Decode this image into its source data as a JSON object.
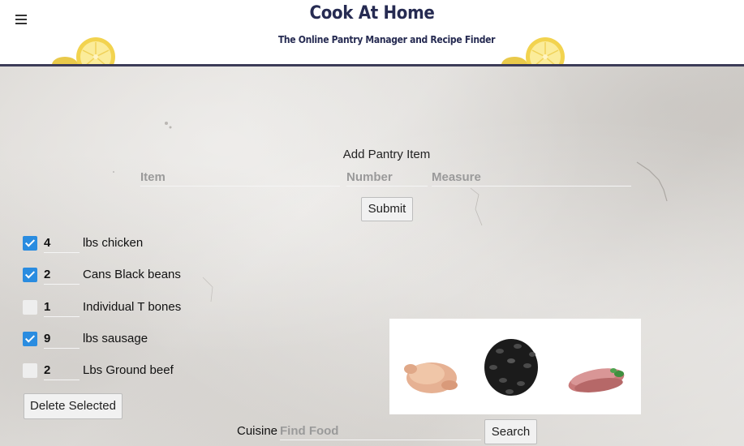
{
  "header": {
    "title": "Cook At Home",
    "subtitle": "The Online Pantry Manager and Recipe Finder"
  },
  "form": {
    "heading": "Add Pantry Item",
    "item_placeholder": "Item",
    "number_placeholder": "Number",
    "measure_placeholder": "Measure",
    "submit_label": "Submit"
  },
  "pantry": {
    "items": [
      {
        "checked": true,
        "quantity": "4",
        "description": "lbs chicken"
      },
      {
        "checked": true,
        "quantity": "2",
        "description": "Cans Black beans"
      },
      {
        "checked": false,
        "quantity": "1",
        "description": "Individual T bones"
      },
      {
        "checked": true,
        "quantity": "9",
        "description": "lbs sausage"
      },
      {
        "checked": false,
        "quantity": "2",
        "description": "Lbs Ground beef"
      }
    ],
    "delete_label": "Delete Selected"
  },
  "search": {
    "cuisine_label": "Cuisine",
    "placeholder": "Find Food",
    "button_label": "Search"
  },
  "colors": {
    "header_text": "#262b52",
    "checkbox_checked": "#2a8ce0",
    "header_border": "#3c3c58"
  }
}
